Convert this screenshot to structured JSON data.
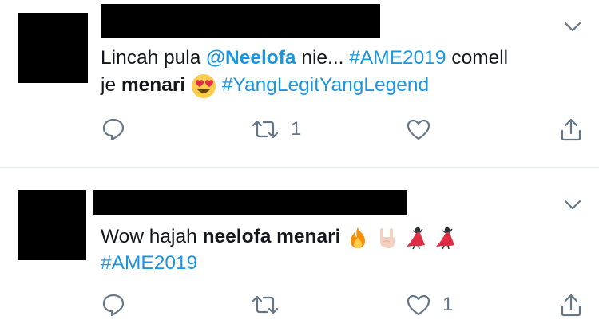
{
  "tweets": [
    {
      "line1": {
        "pre": "Lincah pula ",
        "mention": "@Neelofa",
        "mid": " nie... ",
        "hashtag": "#AME2019",
        "post": " comell"
      },
      "line2": {
        "pre": "je ",
        "bold": "menari",
        "hashtag": "#YangLegitYangLegend"
      },
      "emoji": "heart-eyes-emoji",
      "retweet_count": "1",
      "like_count": ""
    },
    {
      "line1": {
        "pre": "Wow hajah ",
        "bold": "neelofa menari"
      },
      "line2": {
        "hashtag": "#AME2019"
      },
      "emojis": [
        "fire-emoji",
        "rock-on-hand-emoji",
        "dancer-emoji",
        "dancer-emoji"
      ],
      "retweet_count": "",
      "like_count": "1"
    }
  ],
  "colors": {
    "link": "#1b95e0",
    "icon": "#657786",
    "divider": "#e6ecf0"
  }
}
